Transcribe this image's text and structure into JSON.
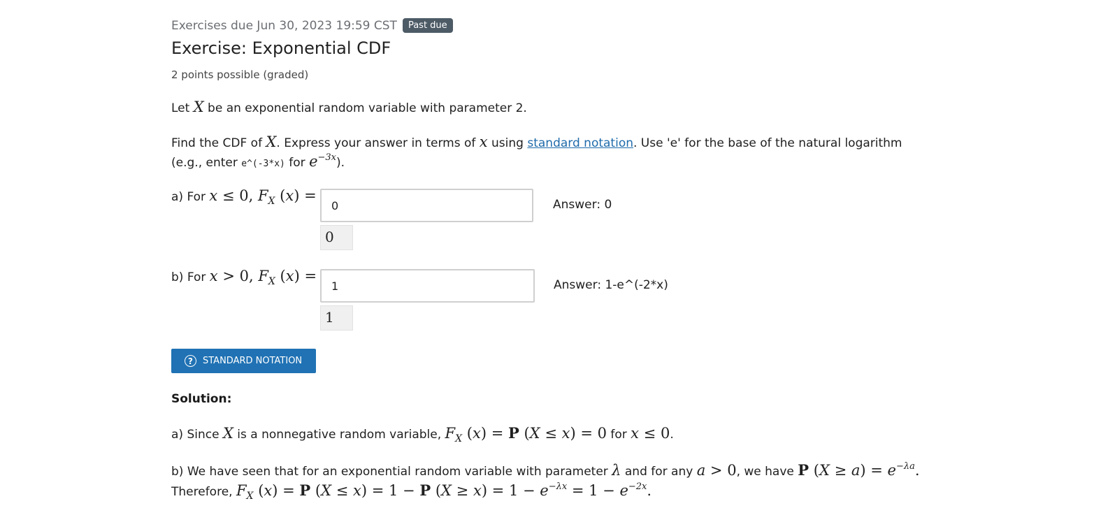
{
  "header": {
    "due_text": "Exercises due Jun 30, 2023 19:59 CST",
    "badge": "Past due",
    "title": "Exercise: Exponential CDF",
    "points": "2 points possible (graded)"
  },
  "problem": {
    "intro_prefix": "Let ",
    "intro_suffix": " be an exponential random variable with parameter 2.",
    "find_prefix": "Find the CDF of ",
    "find_mid": ". Express your answer in terms of ",
    "find_mid2": " using ",
    "link_text": "standard notation",
    "find_suffix": ". Use 'e' for the base of the natural logarithm",
    "eg_prefix": "(e.g., enter ",
    "eg_code": "e^(-3*x)",
    "eg_mid": " for ",
    "eg_suffix": ")."
  },
  "part_a": {
    "label": "a) For ",
    "cond": " ≤ 0, ",
    "input_value": "0",
    "preview": "0",
    "answer": "Answer: 0"
  },
  "part_b": {
    "label": "b) For ",
    "cond": " > 0, ",
    "input_value": "1",
    "preview": "1",
    "answer": "Answer: 1-e^(-2*x)"
  },
  "button": {
    "icon": "question-circle-icon",
    "label": "STANDARD NOTATION"
  },
  "solution": {
    "heading": "Solution:",
    "a_prefix": "a) Since ",
    "a_mid": " is a nonnegative random variable, ",
    "a_mid2": " for ",
    "b_prefix": "b) We have seen that for an exponential random variable with parameter ",
    "b_mid": " and for any ",
    "b_mid2": ", we have ",
    "therefore": "Therefore, "
  }
}
